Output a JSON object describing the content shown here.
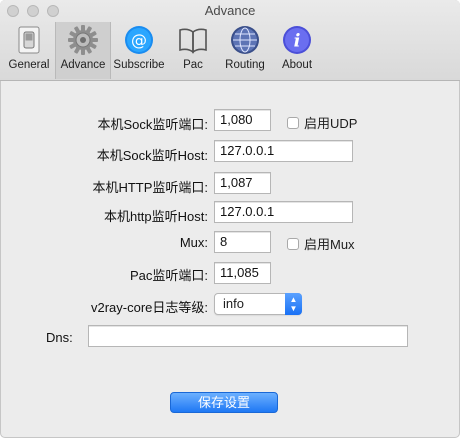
{
  "window": {
    "title": "Advance"
  },
  "toolbar": {
    "items": [
      {
        "label": "General",
        "icon": "switch-icon"
      },
      {
        "label": "Advance",
        "icon": "gear-icon"
      },
      {
        "label": "Subscribe",
        "icon": "at-icon"
      },
      {
        "label": "Pac",
        "icon": "book-icon"
      },
      {
        "label": "Routing",
        "icon": "globe-icon"
      },
      {
        "label": "About",
        "icon": "info-icon"
      }
    ],
    "selected": "Advance"
  },
  "form": {
    "sock_port": {
      "label": "本机Sock监听端口:",
      "value": "1,080"
    },
    "udp": {
      "label": "启用UDP",
      "checked": false
    },
    "sock_host": {
      "label": "本机Sock监听Host:",
      "value": "127.0.0.1"
    },
    "http_port": {
      "label": "本机HTTP监听端口:",
      "value": "1,087"
    },
    "http_host": {
      "label": "本机http监听Host:",
      "value": "127.0.0.1"
    },
    "mux": {
      "label": "Mux:",
      "value": "8"
    },
    "mux_enable": {
      "label": "启用Mux",
      "checked": false
    },
    "pac_port": {
      "label": "Pac监听端口:",
      "value": "11,085"
    },
    "log_level": {
      "label": "v2ray-core日志等级:",
      "value": "info"
    },
    "dns": {
      "label": "Dns:",
      "value": ""
    }
  },
  "actions": {
    "save_label": "保存设置"
  },
  "colors": {
    "accent": "#1f78f4"
  }
}
